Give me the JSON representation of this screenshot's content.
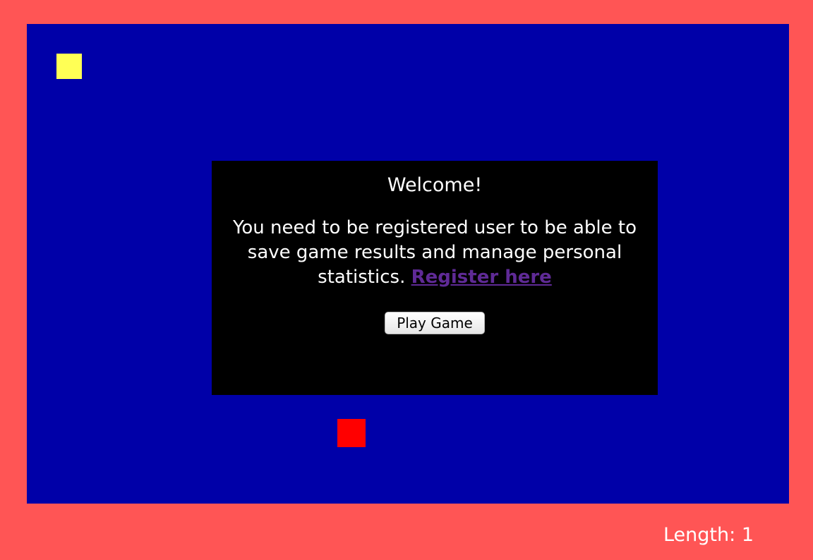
{
  "colors": {
    "page_background": "#ff5555",
    "board_background": "#0000a8",
    "snake": "#ffff55",
    "food": "#ff0000",
    "modal_background": "#000000",
    "modal_text": "#ffffff",
    "link": "#5f2a96"
  },
  "board": {
    "snake_segments": 1,
    "food_count": 1
  },
  "modal": {
    "title": "Welcome!",
    "message": "You need to be registered user to be able to save game results and manage personal statistics.",
    "register_link": "Register here",
    "play_button": "Play Game"
  },
  "status": {
    "length_label": "Length:",
    "length_value": "1"
  }
}
